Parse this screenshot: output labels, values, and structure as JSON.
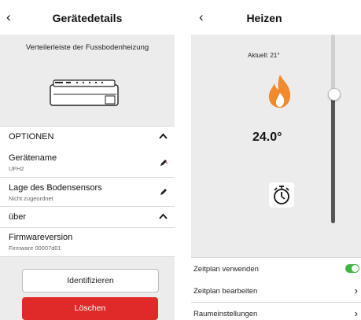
{
  "left": {
    "back_icon": "‹",
    "title": "Gerätedetails",
    "subtitle": "Verteilerleiste der Fussbodenheizung",
    "device_icon": "floor-heating-manifold",
    "options_header": "OPTIONEN",
    "device_name": {
      "label": "Gerätename",
      "value": "UFH2"
    },
    "sensor_location": {
      "label": "Lage des Bodensensors",
      "value": "Nicht zugeordnet"
    },
    "about_header": "über",
    "firmware": {
      "label": "Firmwareversion",
      "value": "Firmware 00007d01"
    },
    "identify_button": "Identifizieren",
    "delete_button": "Löschen",
    "colors": {
      "delete": "#e02a2a",
      "panel": "#ececec"
    }
  },
  "right": {
    "back_icon": "‹",
    "title": "Heizen",
    "current": "Aktuell: 21°",
    "setpoint": "24.0°",
    "setpoint_slider_level": 0.68,
    "flame_icon": "flame-icon",
    "timer_icon": "timer-icon",
    "rows": [
      {
        "label": "Zeitplan verwenden",
        "control": "toggle",
        "state": "on"
      },
      {
        "label": "Zeitplan bearbeiten",
        "control": "arrow",
        "arrow": "›"
      },
      {
        "label": "Raumeinstellungen",
        "control": "arrow",
        "arrow": "›"
      }
    ],
    "colors": {
      "flame": "#f08a2c",
      "toggle_on": "#3db83f"
    }
  }
}
